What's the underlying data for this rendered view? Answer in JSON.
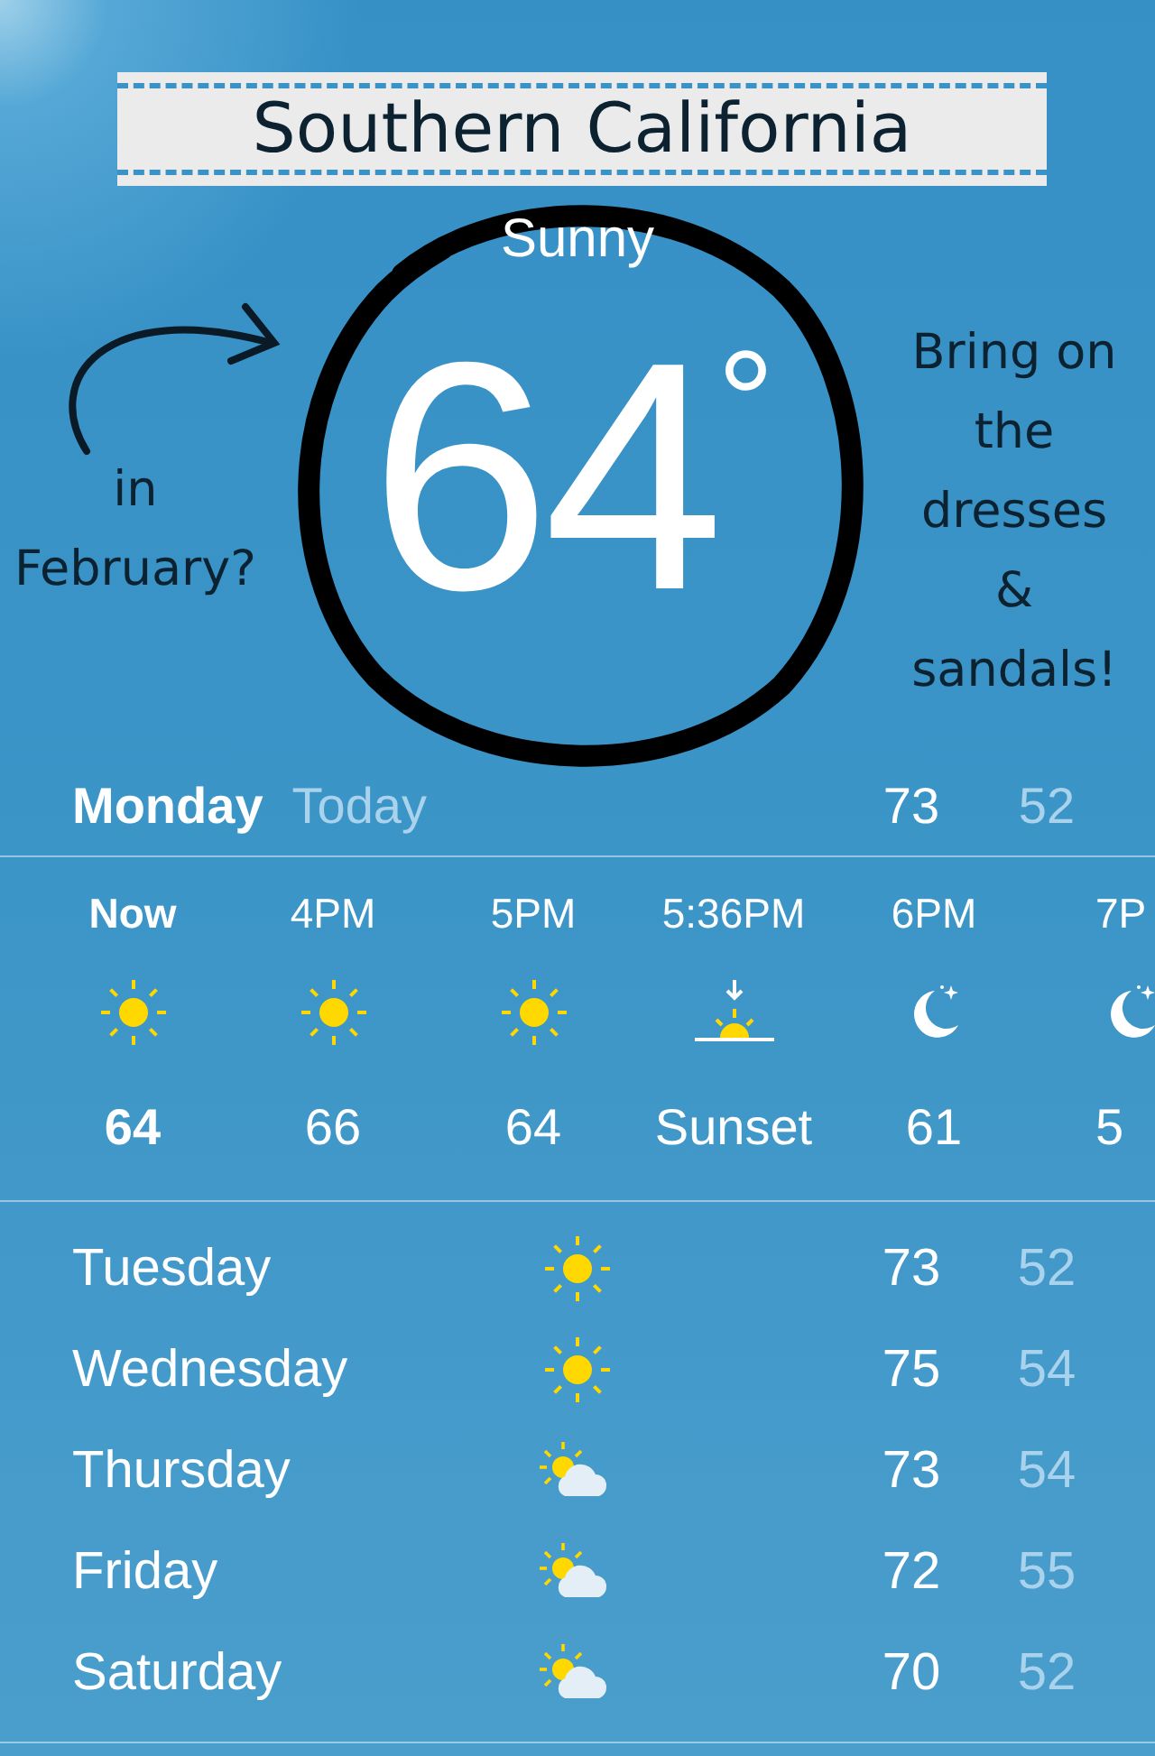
{
  "location": "Southern California",
  "condition": "Sunny",
  "temperature": "64",
  "degree": "°",
  "annotations": [
    {
      "kind": "left",
      "lines": [
        "in",
        "February?"
      ]
    },
    {
      "kind": "right",
      "lines": [
        "Bring on",
        "the",
        "dresses",
        "&",
        "sandals!"
      ]
    }
  ],
  "today": {
    "day": "Monday",
    "label": "Today",
    "high": "73",
    "low": "52"
  },
  "hourly": [
    {
      "time": "Now",
      "kind": "sun",
      "value": "64",
      "now": true
    },
    {
      "time": "4PM",
      "kind": "sun",
      "value": "66",
      "now": false
    },
    {
      "time": "5PM",
      "kind": "sun",
      "value": "64",
      "now": false
    },
    {
      "time": "5:36PM",
      "kind": "sunset",
      "value": "Sunset",
      "now": false
    },
    {
      "time": "6PM",
      "kind": "moon",
      "value": "61",
      "now": false
    },
    {
      "time": "7P",
      "kind": "moon",
      "value": "5",
      "now": false
    }
  ],
  "daily": [
    {
      "day": "Tuesday",
      "kind": "sun",
      "high": "73",
      "low": "52"
    },
    {
      "day": "Wednesday",
      "kind": "sun",
      "high": "75",
      "low": "54"
    },
    {
      "day": "Thursday",
      "kind": "partly-cloudy",
      "high": "73",
      "low": "54"
    },
    {
      "day": "Friday",
      "kind": "partly-cloudy",
      "high": "72",
      "low": "55"
    },
    {
      "day": "Saturday",
      "kind": "partly-cloudy",
      "high": "70",
      "low": "52"
    }
  ]
}
